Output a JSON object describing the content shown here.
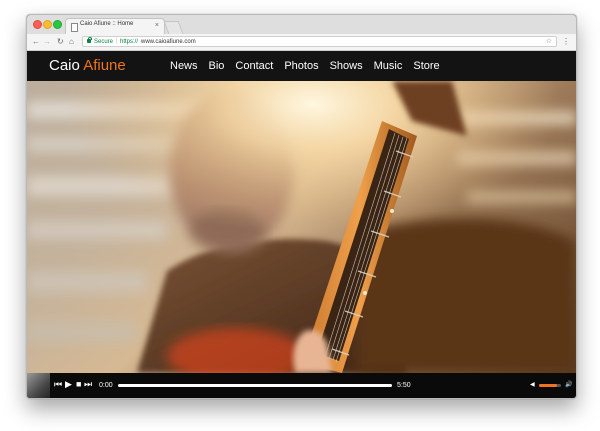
{
  "browser": {
    "tab_title": "Caio Afiune :: Home",
    "tab_close": "×",
    "security_label": "Secure",
    "url_scheme": "https://",
    "url_host": "www.caioafiune.com",
    "url_separator": "|",
    "icons": {
      "back": "←",
      "forward": "→",
      "reload": "↻",
      "home": "⌂",
      "star": "☆",
      "menu": "⋮"
    }
  },
  "site": {
    "brand_first": "Caio",
    "brand_accent": "Afiune",
    "accent_color": "#f0731f",
    "nav": [
      "News",
      "Bio",
      "Contact",
      "Photos",
      "Shows",
      "Music",
      "Store"
    ]
  },
  "player": {
    "icons": {
      "prev": "⏮",
      "play": "▶",
      "stop": "■",
      "next": "⏭",
      "volume_low": "◀",
      "volume_high": "🔊"
    },
    "current_time": "0:00",
    "total_time": "5:50",
    "progress_fraction": 0.0,
    "volume_fraction": 0.8
  }
}
